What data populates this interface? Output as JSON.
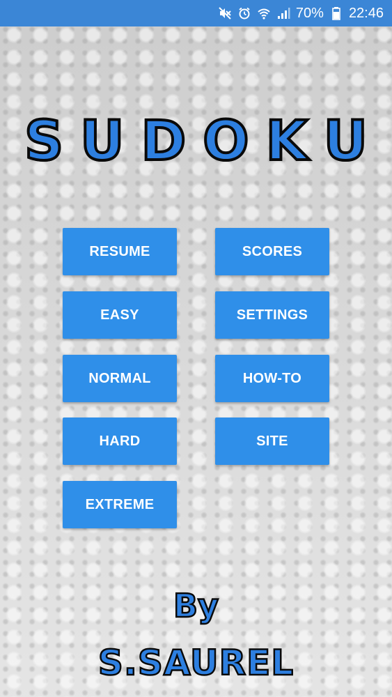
{
  "status_bar": {
    "battery_text": "70%",
    "time": "22:46",
    "icons": [
      "mute-icon",
      "alarm-icon",
      "wifi-icon",
      "signal-icon",
      "battery-icon"
    ]
  },
  "title": "SUDOKU",
  "menu": {
    "resume": "RESUME",
    "scores": "SCORES",
    "easy": "EASY",
    "settings": "SETTINGS",
    "normal": "NORMAL",
    "how_to": "HOW-TO",
    "hard": "HARD",
    "site": "SITE",
    "extreme": "EXTREME"
  },
  "credit": {
    "by": "By",
    "name": "S.SAUREL"
  },
  "colors": {
    "status_bar": "#3b86d6",
    "button": "#2f8fe9",
    "title": "#2d7fe0",
    "outline": "#0a0a0a"
  }
}
